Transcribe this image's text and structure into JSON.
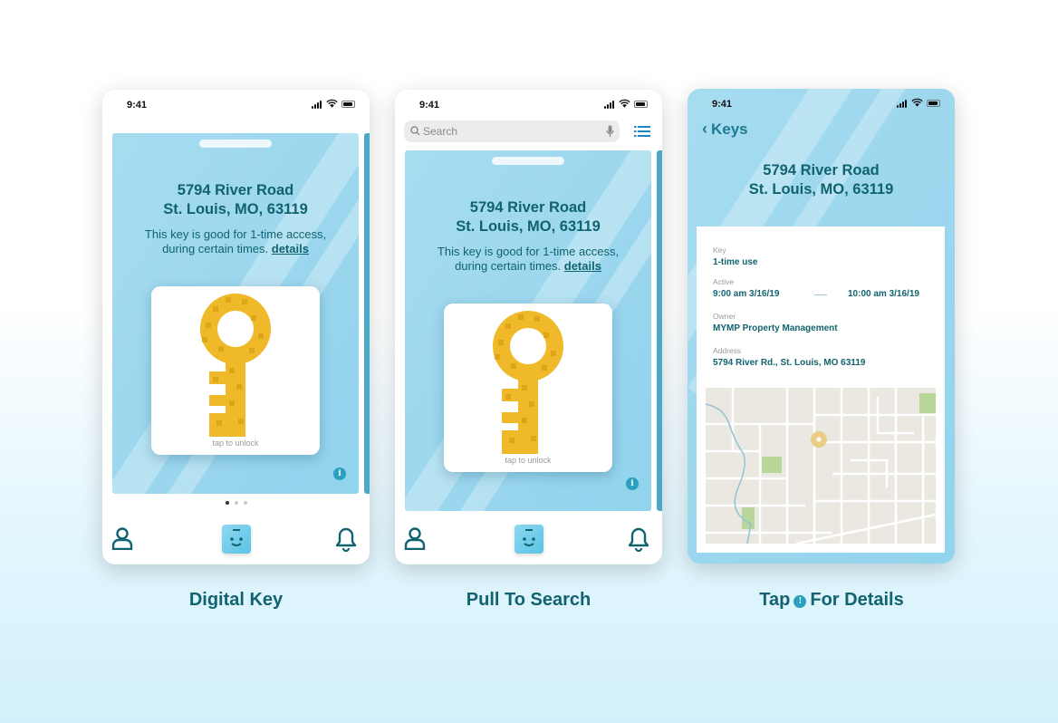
{
  "screens": [
    {
      "status_time": "9:41",
      "address_line1": "5794 River Road",
      "address_line2": "St. Louis, MO, 63119",
      "desc_line1": "This key is good for 1-time access,",
      "desc_line2": "during certain times.",
      "details_link": "details",
      "tap_label": "tap to unlock",
      "info_glyph": "i",
      "caption": "Digital Key"
    },
    {
      "status_time": "9:41",
      "search_placeholder": "Search",
      "address_line1": "5794 River Road",
      "address_line2": "St. Louis, MO, 63119",
      "desc_line1": "This key is good for 1-time access,",
      "desc_line2": "during certain times.",
      "details_link": "details",
      "tap_label": "tap to unlock",
      "info_glyph": "i",
      "caption": "Pull To Search"
    },
    {
      "status_time": "9:41",
      "back_label": "Keys",
      "address_line1": "5794 River Road",
      "address_line2": "St. Louis, MO, 63119",
      "details": {
        "key_label": "Key",
        "key_value": "1-time use",
        "active_label": "Active",
        "active_start": "9:00 am  3/16/19",
        "active_end": "10:00 am  3/16/19",
        "owner_label": "Owner",
        "owner_value": "MYMP Property Management",
        "address_label": "Address",
        "address_value": "5794 River Rd., St. Louis, MO 63119"
      },
      "caption_prefix": "Tap",
      "caption_glyph": "!",
      "caption_suffix": "For Details"
    }
  ],
  "pager": {
    "total": 3,
    "active": 0
  },
  "icons": [
    "signal-icon",
    "wifi-icon",
    "battery-icon",
    "search-icon",
    "mic-icon",
    "list-icon",
    "person-icon",
    "face-icon",
    "bell-icon",
    "info-icon",
    "key-icon",
    "map-pin-icon",
    "chevron-left-icon"
  ],
  "colors": {
    "accent": "#10636f",
    "card": "#98d6ee",
    "key_gold": "#f0b929",
    "info": "#2a9fc0"
  }
}
